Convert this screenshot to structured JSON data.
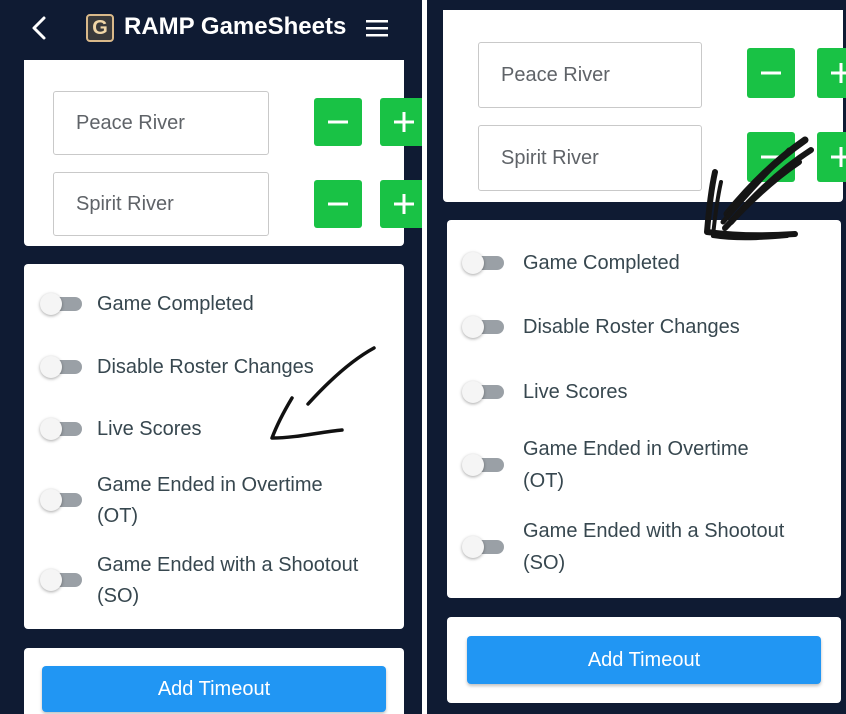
{
  "header": {
    "logo_letter": "G",
    "title": "RAMP GameSheets"
  },
  "teams": [
    {
      "name": "Peace River"
    },
    {
      "name": "Spirit River"
    }
  ],
  "buttons": {
    "decrement": "−",
    "increment": "+",
    "add_timeout": "Add Timeout"
  },
  "toggles": [
    {
      "label": "Game Completed",
      "on": false
    },
    {
      "label": "Disable Roster Changes",
      "on": false
    },
    {
      "label": "Live Scores",
      "on": false
    },
    {
      "label_line1": "Game Ended in Overtime",
      "label_line2": "(OT)",
      "on": false
    },
    {
      "label_line1": "Game Ended with a Shootout",
      "label_line2": "(SO)",
      "on": false
    }
  ],
  "colors": {
    "background": "#0f1b33",
    "green": "#19c245",
    "blue": "#2196f3",
    "toggle_off": "#9aa0a6"
  },
  "icons": [
    "back-icon",
    "app-logo-icon",
    "menu-icon",
    "minus-icon",
    "plus-icon",
    "arrow-annotation"
  ]
}
